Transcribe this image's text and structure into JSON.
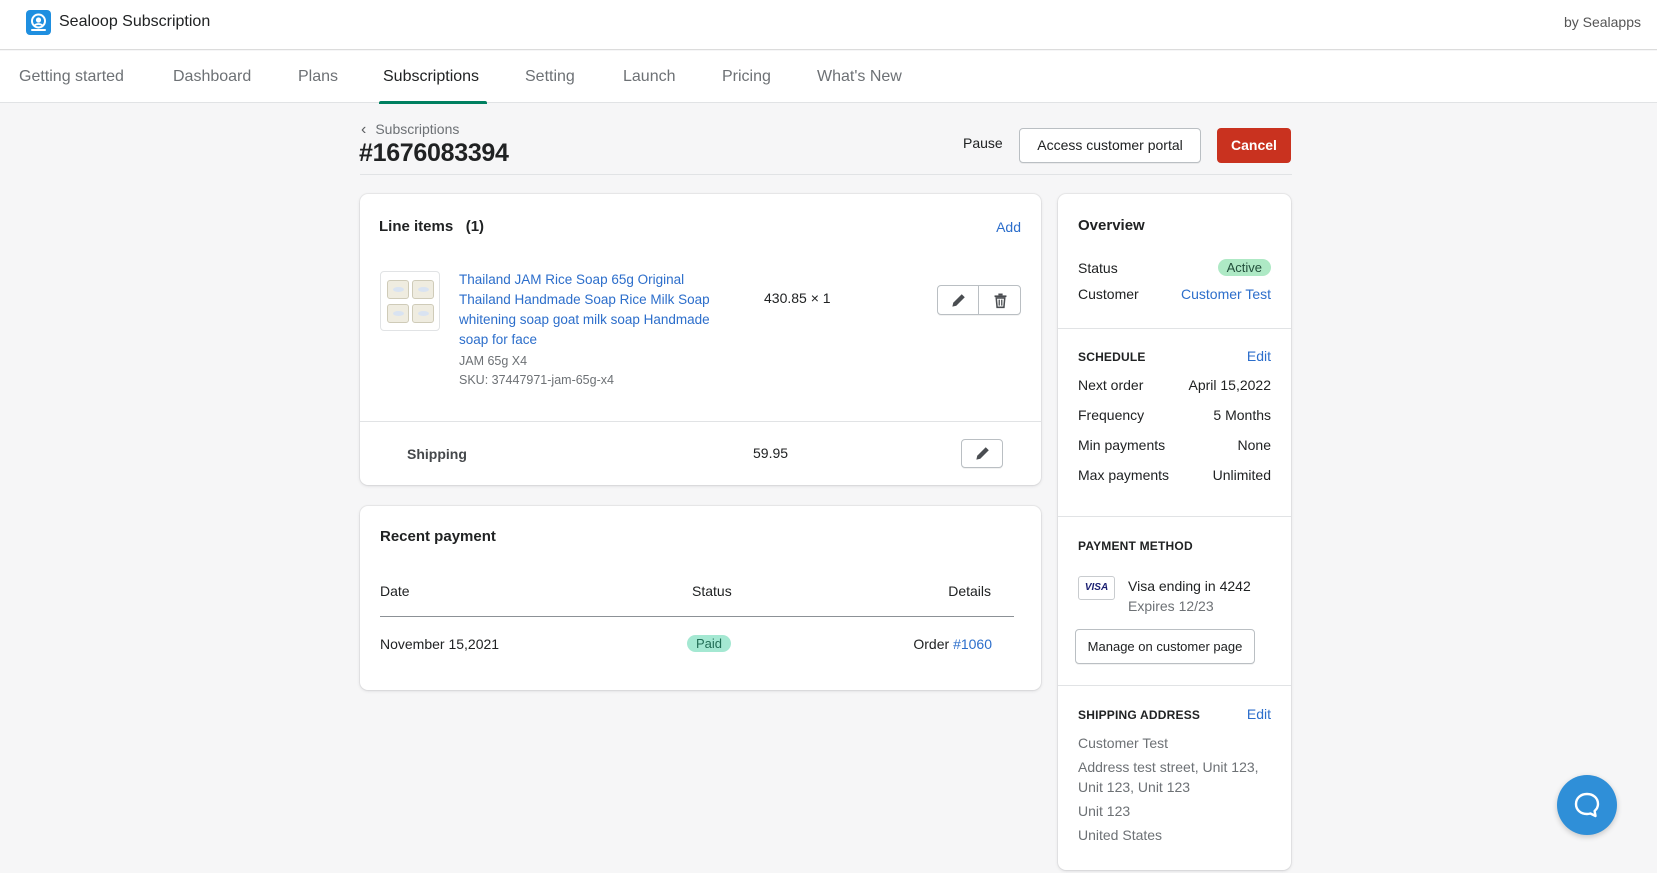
{
  "app": {
    "title": "Sealoop Subscription",
    "by": "by Sealapps"
  },
  "nav": {
    "tabs": [
      "Getting started",
      "Dashboard",
      "Plans",
      "Subscriptions",
      "Setting",
      "Launch",
      "Pricing",
      "What's New"
    ],
    "active": "Subscriptions"
  },
  "header": {
    "breadcrumb": "Subscriptions",
    "title": "#1676083394",
    "pause_label": "Pause",
    "portal_label": "Access customer portal",
    "cancel_label": "Cancel"
  },
  "line_items": {
    "title": "Line items",
    "count": "(1)",
    "add_label": "Add",
    "items": [
      {
        "name": "Thailand JAM Rice Soap 65g Original Thailand Handmade Soap Rice Milk Soap whitening soap goat milk soap Handmade soap for face",
        "variant": "JAM 65g X4",
        "sku": "SKU: 37447971-jam-65g-x4",
        "price_qty": "430.85 × 1"
      }
    ],
    "shipping_label": "Shipping",
    "shipping_value": "59.95"
  },
  "recent_payment": {
    "title": "Recent payment",
    "columns": [
      "Date",
      "Status",
      "Details"
    ],
    "rows": [
      {
        "date": "November 15,2021",
        "status": "Paid",
        "details_prefix": "Order",
        "order": "#1060"
      }
    ]
  },
  "overview": {
    "title": "Overview",
    "status_label": "Status",
    "status_value": "Active",
    "customer_label": "Customer",
    "customer_value": "Customer Test"
  },
  "schedule": {
    "heading": "SCHEDULE",
    "edit_label": "Edit",
    "rows": [
      {
        "label": "Next order",
        "value": "April 15,2022"
      },
      {
        "label": "Frequency",
        "value": "5 Months"
      },
      {
        "label": "Min payments",
        "value": "None"
      },
      {
        "label": "Max payments",
        "value": "Unlimited"
      }
    ]
  },
  "payment_method": {
    "heading": "PAYMENT METHOD",
    "card_brand": "VISA",
    "card_text": "Visa ending in 4242",
    "expires": "Expires 12/23",
    "manage_label": "Manage on customer page"
  },
  "shipping_address": {
    "heading": "SHIPPING ADDRESS",
    "edit_label": "Edit",
    "name": "Customer Test",
    "line1": "Address test street, Unit 123,",
    "line2": "Unit 123, Unit 123",
    "line3": "Unit 123",
    "country": "United States"
  },
  "colors": {
    "accent": "#008060",
    "link": "#2c6ecb",
    "danger": "#c9321f",
    "chat": "#2f8fd8"
  },
  "icons": {
    "logo": "app-logo-icon",
    "chat": "chat-bubble-icon",
    "edit": "pencil-icon",
    "delete": "trash-icon"
  }
}
